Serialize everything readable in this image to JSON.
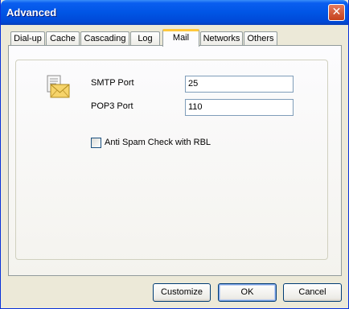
{
  "window": {
    "title": "Advanced",
    "close_glyph": "✕"
  },
  "tabs": [
    {
      "label": "Dial-up"
    },
    {
      "label": "Cache"
    },
    {
      "label": "Cascading"
    },
    {
      "label": "Log"
    },
    {
      "label": "Mail",
      "active": true
    },
    {
      "label": "Networks"
    },
    {
      "label": "Others"
    }
  ],
  "mail": {
    "icon": "mail-envelope-icon",
    "smtp_label": "SMTP Port",
    "smtp_value": "25",
    "pop3_label": "POP3 Port",
    "pop3_value": "110",
    "antispam_label": "Anti Spam Check with RBL",
    "antispam_checked": false
  },
  "buttons": {
    "customize": "Customize",
    "ok": "OK",
    "cancel": "Cancel"
  },
  "colors": {
    "titlebar": "#0055e5",
    "active_tab_accent": "#ffc83c",
    "face": "#ece9d8"
  }
}
